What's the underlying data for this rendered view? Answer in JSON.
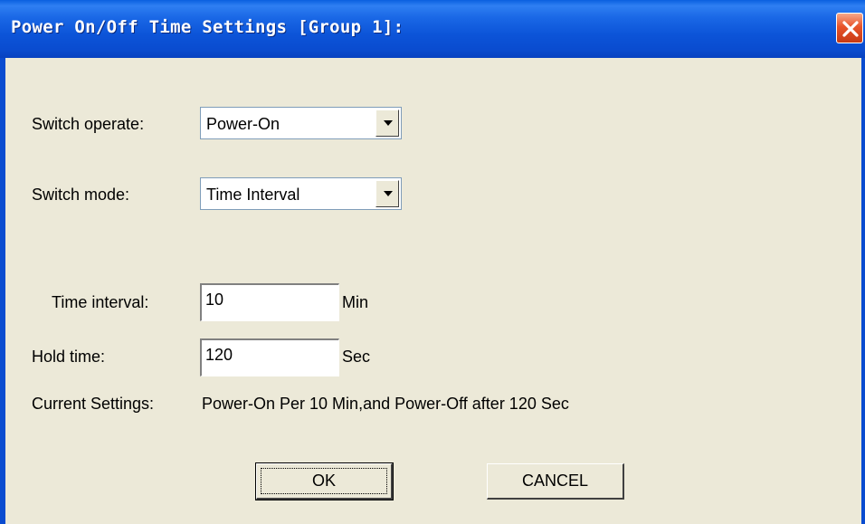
{
  "window": {
    "title": "Power On/Off Time Settings [Group 1]:"
  },
  "icons": {
    "close": "close-icon",
    "dropdown": "chevron-down-icon"
  },
  "form": {
    "switch_operate": {
      "label": "Switch operate:",
      "value": "Power-On"
    },
    "switch_mode": {
      "label": "Switch  mode:",
      "value": "Time Interval"
    },
    "time_interval": {
      "label": "Time interval:",
      "value": "10",
      "unit": "Min"
    },
    "hold_time": {
      "label": "Hold time:",
      "value": "120",
      "unit": "Sec"
    },
    "current_settings": {
      "label": "Current Settings:",
      "value": "Power-On Per 10 Min,and Power-Off after 120 Sec"
    }
  },
  "buttons": {
    "ok": "OK",
    "cancel": "CANCEL"
  },
  "colors": {
    "titlebar": "#0a4cd0",
    "face": "#ece9d8",
    "close": "#e8542a"
  }
}
